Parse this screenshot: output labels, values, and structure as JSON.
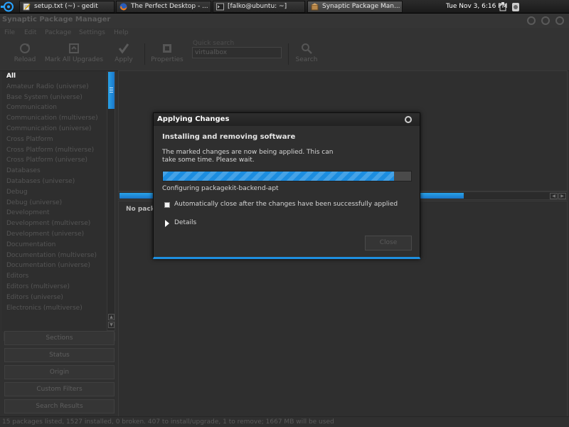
{
  "taskbar": {
    "tasks": [
      {
        "label": "setup.txt (~) - gedit",
        "icon": "gedit-icon"
      },
      {
        "label": "The Perfect Desktop - ...",
        "icon": "firefox-icon"
      },
      {
        "label": "[falko@ubuntu: ~]",
        "icon": "terminal-icon"
      },
      {
        "label": "Synaptic Package Man...",
        "icon": "synaptic-icon"
      }
    ],
    "clock": "Tue Nov  3,  6:16 PM",
    "tray_icons": [
      "network-icon",
      "update-notifier-icon"
    ]
  },
  "window": {
    "title": "Synaptic Package Manager",
    "menu": [
      "File",
      "Edit",
      "Package",
      "Settings",
      "Help"
    ]
  },
  "toolbar": {
    "reload": "Reload",
    "mark_all_upgrades": "Mark All Upgrades",
    "apply": "Apply",
    "properties": "Properties",
    "quick_search_label": "Quick search",
    "quick_search_value": "virtualbox",
    "search": "Search"
  },
  "categories": [
    "All",
    "Amateur Radio (universe)",
    "Base System (universe)",
    "Communication",
    "Communication (multiverse)",
    "Communication (universe)",
    "Cross Platform",
    "Cross Platform (multiverse)",
    "Cross Platform (universe)",
    "Databases",
    "Databases (universe)",
    "Debug",
    "Debug (universe)",
    "Development",
    "Development (multiverse)",
    "Development (universe)",
    "Documentation",
    "Documentation (multiverse)",
    "Documentation (universe)",
    "Editors",
    "Editors (multiverse)",
    "Editors (universe)",
    "Electronics (multiverse)"
  ],
  "filter_buttons": [
    "Sections",
    "Status",
    "Origin",
    "Custom Filters",
    "Search Results"
  ],
  "description_pane": {
    "text": "No packa"
  },
  "status_bar": "15 packages listed, 1527 installed, 0 broken. 407 to install/upgrade, 1 to remove; 1667 MB will be used",
  "dialog": {
    "title": "Applying Changes",
    "heading": "Installing and removing software",
    "message": "The marked changes are now being applied. This can take some time. Please wait.",
    "progress": 0.93,
    "status": "Configuring packagekit-backend-apt",
    "auto_close_label": "Automatically close after the changes have been successfully applied",
    "auto_close_checked": false,
    "details_label": "Details",
    "close_button": "Close"
  },
  "colors": {
    "accent": "#1e8fe0",
    "selection_text": "#ffffff"
  }
}
